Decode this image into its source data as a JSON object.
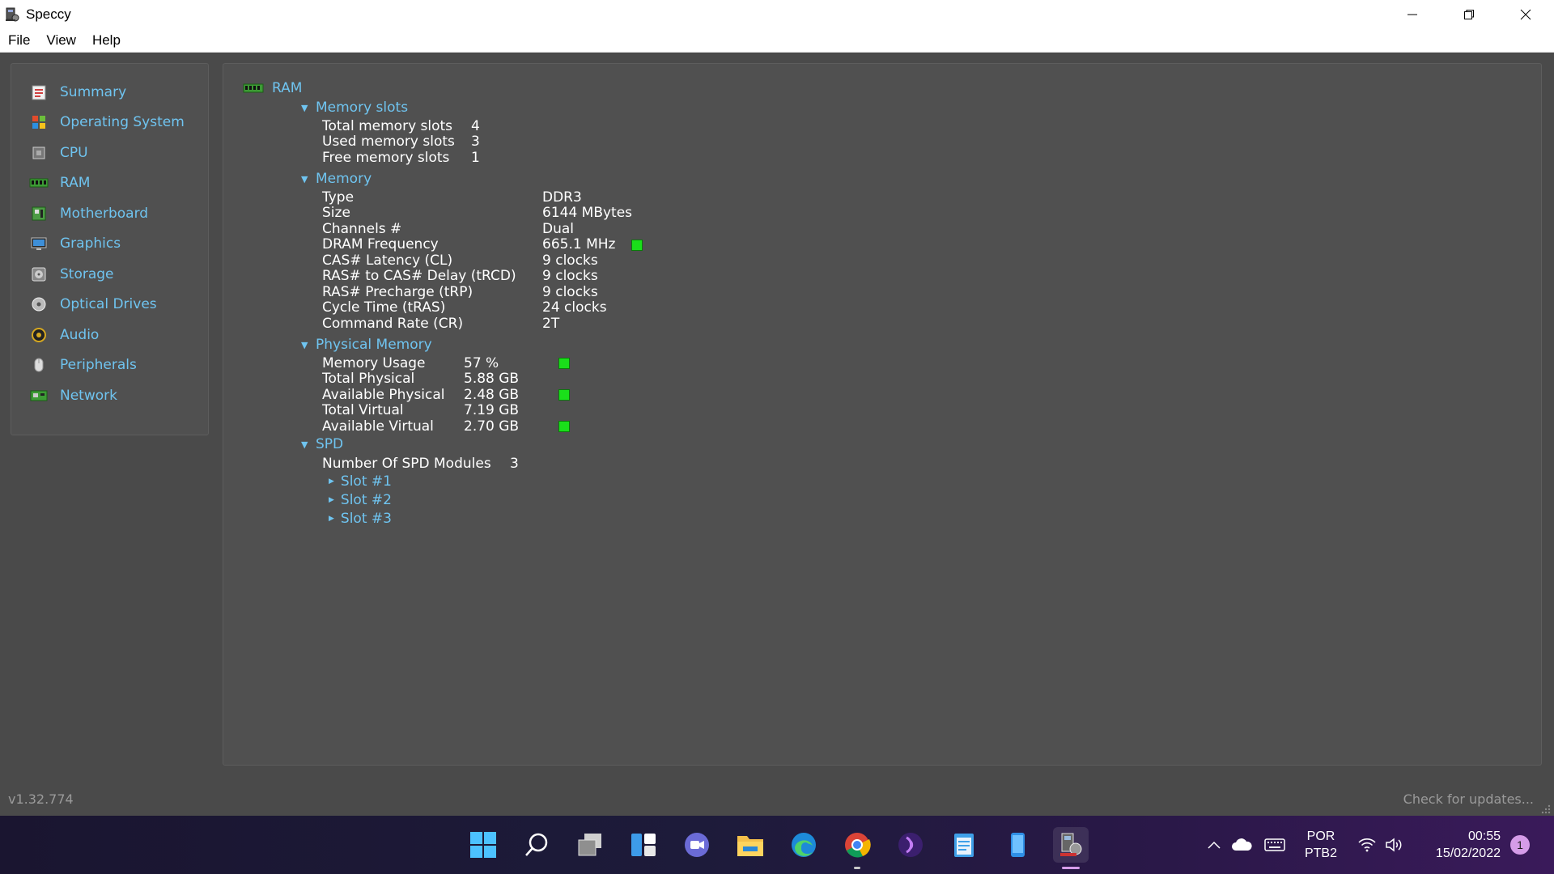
{
  "window": {
    "title": "Speccy"
  },
  "menu": {
    "items": [
      "File",
      "View",
      "Help"
    ]
  },
  "sidebar": {
    "items": [
      {
        "label": "Summary",
        "icon": "summary-icon"
      },
      {
        "label": "Operating System",
        "icon": "windows-flag-icon"
      },
      {
        "label": "CPU",
        "icon": "cpu-icon"
      },
      {
        "label": "RAM",
        "icon": "ram-icon"
      },
      {
        "label": "Motherboard",
        "icon": "motherboard-icon"
      },
      {
        "label": "Graphics",
        "icon": "monitor-icon"
      },
      {
        "label": "Storage",
        "icon": "storage-icon"
      },
      {
        "label": "Optical Drives",
        "icon": "disc-icon"
      },
      {
        "label": "Audio",
        "icon": "speaker-icon"
      },
      {
        "label": "Peripherals",
        "icon": "mouse-icon"
      },
      {
        "label": "Network",
        "icon": "network-icon"
      }
    ]
  },
  "main": {
    "title": "RAM",
    "memory_slots": {
      "heading": "Memory slots",
      "rows": [
        {
          "k": "Total memory slots",
          "v": "4"
        },
        {
          "k": "Used memory slots",
          "v": "3"
        },
        {
          "k": "Free memory slots",
          "v": "1"
        }
      ]
    },
    "memory": {
      "heading": "Memory",
      "rows": [
        {
          "k": "Type",
          "v": "DDR3"
        },
        {
          "k": "Size",
          "v": "6144 MBytes"
        },
        {
          "k": "Channels #",
          "v": "Dual"
        },
        {
          "k": "DRAM Frequency",
          "v": "665.1 MHz"
        },
        {
          "k": "CAS# Latency (CL)",
          "v": "9 clocks"
        },
        {
          "k": "RAS# to CAS# Delay (tRCD)",
          "v": "9 clocks"
        },
        {
          "k": "RAS# Precharge (tRP)",
          "v": "9 clocks"
        },
        {
          "k": "Cycle Time (tRAS)",
          "v": "24 clocks"
        },
        {
          "k": "Command Rate (CR)",
          "v": "2T"
        }
      ]
    },
    "physical_memory": {
      "heading": "Physical Memory",
      "rows": [
        {
          "k": "Memory Usage",
          "v": "57 %"
        },
        {
          "k": "Total Physical",
          "v": "5.88 GB"
        },
        {
          "k": "Available Physical",
          "v": "2.48 GB"
        },
        {
          "k": "Total Virtual",
          "v": "7.19 GB"
        },
        {
          "k": "Available Virtual",
          "v": "2.70 GB"
        }
      ]
    },
    "spd": {
      "heading": "SPD",
      "modules_label": "Number Of SPD Modules",
      "modules_value": "3",
      "slots": [
        "Slot #1",
        "Slot #2",
        "Slot #3"
      ]
    }
  },
  "status": {
    "version": "v1.32.774",
    "check_updates": "Check for updates..."
  },
  "taskbar": {
    "apps": [
      "start-icon",
      "search-icon",
      "task-view-icon",
      "widgets-icon",
      "chat-icon",
      "file-explorer-icon",
      "edge-icon",
      "chrome-icon",
      "podcast-app-icon",
      "notepad-icon",
      "phone-app-icon",
      "speccy-icon"
    ],
    "tray": {
      "lang_line1": "POR",
      "lang_line2": "PTB2",
      "time": "00:55",
      "date": "15/02/2022",
      "notifications": "1"
    }
  },
  "colors": {
    "accent": "#6fc4f0",
    "led": "#1adf1a",
    "panel": "#505050",
    "background": "#4a4a4a"
  }
}
